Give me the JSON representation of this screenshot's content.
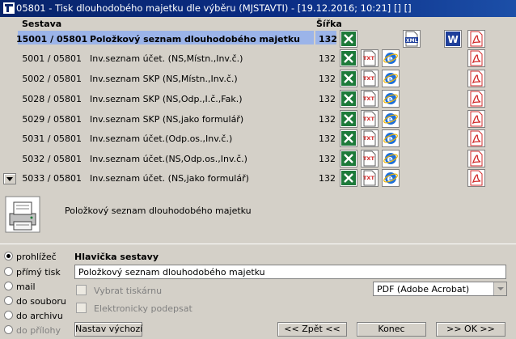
{
  "window": {
    "title": "05801 - Tisk dlouhodobého majetku dle výběru (MJSTAVTI) - [19.12.2016; 10:21] [] []"
  },
  "table": {
    "col_sestava": "Sestava",
    "col_sirka": "Šířka",
    "rows": [
      {
        "code": "15001 / 05801",
        "name": "Položkový seznam dlouhodobého majetku",
        "width": "132",
        "selected": true
      },
      {
        "code": "5001 / 05801",
        "name": "Inv.seznam účet. (NS,Místn.,Inv.č.)",
        "width": "132"
      },
      {
        "code": "5002 / 05801",
        "name": "Inv.seznam SKP (NS,Místn.,Inv.č.)",
        "width": "132"
      },
      {
        "code": "5028 / 05801",
        "name": "Inv.seznam SKP (NS,Odp.,I.č.,Fak.)",
        "width": "132"
      },
      {
        "code": "5029 / 05801",
        "name": "Inv.seznam SKP (NS,jako formulář)",
        "width": "132"
      },
      {
        "code": "5031 / 05801",
        "name": "Inv.seznam účet.(Odp.os.,Inv.č.)",
        "width": "132"
      },
      {
        "code": "5032 / 05801",
        "name": "Inv.seznam účet.(NS,Odp.os.,Inv.č.)",
        "width": "132"
      },
      {
        "code": "5033 / 05801",
        "name": "Inv.seznam účet. (NS,jako formulář)",
        "width": "132"
      }
    ],
    "icons": {
      "excel": "excel-icon",
      "txt": "txt-icon",
      "html": "html-ie-icon",
      "xml": "xml-icon",
      "word": "word-icon",
      "pdf": "pdf-icon"
    }
  },
  "description": "Položkový seznam dlouhodobého majetku",
  "output": {
    "options": [
      {
        "label": "prohlížeč",
        "checked": true
      },
      {
        "label": "přímý tisk"
      },
      {
        "label": "mail"
      },
      {
        "label": "do souboru"
      },
      {
        "label": "do archivu"
      },
      {
        "label": "do přílohy",
        "disabled": true
      }
    ]
  },
  "header_section": {
    "label": "Hlavička sestavy",
    "value": "Položkový seznam dlouhodobého majetku",
    "select_printer": "Vybrat tiskárnu",
    "e_signature": "Elektronicky podepsat",
    "format": "PDF (Adobe Acrobat)"
  },
  "buttons": {
    "defaults": "Nastav výchozí",
    "back": "<< Zpět <<",
    "end": "Konec",
    "ok": ">> OK >>"
  },
  "colors": {
    "selection": "#9bb4e9",
    "titlebar": "#0a246a",
    "excel": "#1d7a3a",
    "pdf": "#d12b2b",
    "ie": "#1e6fd9",
    "word": "#1f3f9a"
  }
}
